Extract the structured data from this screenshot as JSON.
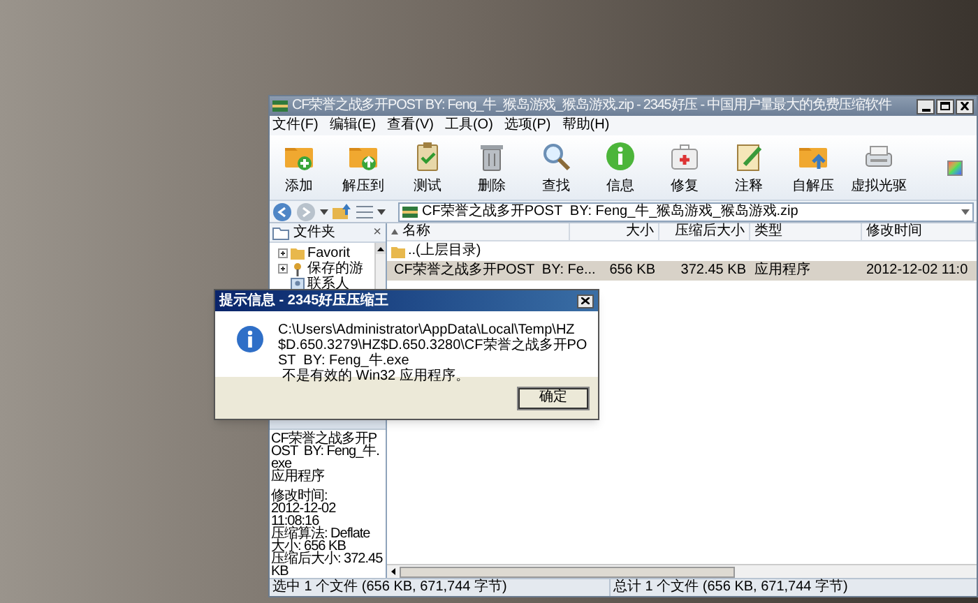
{
  "window": {
    "title": "CF荣誉之战多开POST  BY: Feng_牛_猴岛游戏_猴岛游戏.zip - 2345好压 - 中国用户量最大的免费压缩软件"
  },
  "menu": [
    "文件(F)",
    "编辑(E)",
    "查看(V)",
    "工具(O)",
    "选项(P)",
    "帮助(H)"
  ],
  "toolbar": [
    {
      "label": "添加",
      "kind": "add"
    },
    {
      "label": "解压到",
      "kind": "extract"
    },
    {
      "label": "测试",
      "kind": "test"
    },
    {
      "label": "删除",
      "kind": "delete"
    },
    {
      "label": "查找",
      "kind": "find"
    },
    {
      "label": "信息",
      "kind": "info"
    },
    {
      "label": "修复",
      "kind": "repair"
    },
    {
      "label": "注释",
      "kind": "comment"
    },
    {
      "label": "自解压",
      "kind": "sfx"
    },
    {
      "label": "虚拟光驱",
      "kind": "drive"
    }
  ],
  "address": {
    "value": "CF荣誉之战多开POST  BY: Feng_牛_猴岛游戏_猴岛游戏.zip"
  },
  "folder_panel": {
    "title": "文件夹",
    "close": "×",
    "tree": [
      {
        "label": "Favorit",
        "expandable": true
      },
      {
        "label": "保存的游",
        "expandable": true
      },
      {
        "label": "联系人",
        "expandable": false
      }
    ]
  },
  "details": {
    "name": "CF荣誉之战多开POST  BY: Feng_牛.exe",
    "type": "应用程序",
    "lines": [
      "修改时间:",
      "2012-12-02",
      "11:08:16",
      "压缩算法: Deflate",
      "大小: 656 KB",
      "压缩后大小: 372.45 KB"
    ]
  },
  "table": {
    "columns": [
      "名称",
      "大小",
      "压缩后大小",
      "类型",
      "修改时间"
    ],
    "rows": [
      {
        "kind": "parent",
        "cells": [
          "..(上层目录)",
          "",
          "",
          "",
          ""
        ],
        "selected": false
      },
      {
        "kind": "file",
        "cells": [
          "CF荣誉之战多开POST  BY: Fe...",
          "656 KB",
          "372.45 KB",
          "应用程序",
          "2012-12-02 11:0"
        ],
        "selected": true
      }
    ]
  },
  "status_bar": [
    "选中 1 个文件 (656 KB, 671,744 字节)",
    "总计 1 个文件 (656 KB, 671,744 字节)"
  ],
  "dialog": {
    "title": "提示信息 - 2345好压压缩王",
    "message_lines": [
      "C:\\Users\\Administrator\\AppData\\Local\\Temp\\HZ$D.650.3279\\HZ$D.650.3280\\CF荣誉之战多开POST  BY: Feng_牛.exe",
      "不是有效的 Win32 应用程序。"
    ],
    "button": "确定"
  }
}
